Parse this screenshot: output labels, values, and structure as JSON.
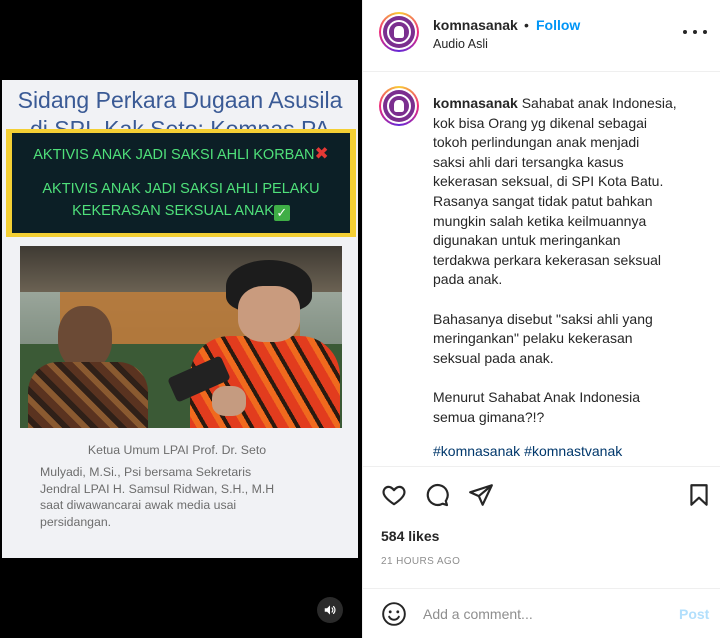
{
  "media": {
    "heading_line1": "Sidang Perkara Dugaan Asusila",
    "heading_line2": "di SPI, Kak Seto: Komnas PA",
    "banner_line1": "AKTIVIS ANAK JADI SAKSI AHLI KORBAN",
    "banner_line2": "AKTIVIS ANAK JADI SAKSI AHLI PELAKU",
    "banner_line3": "KEKERASAN SEKSUAL ANAK",
    "photo_caption": {
      "line1": "Ketua Umum LPAI Prof. Dr. Seto",
      "line2": "Mulyadi, M.Si., Psi bersama Sekretaris",
      "line3": "Jendral LPAI H. Samsul Ridwan, S.H., M.H",
      "line4": "saat diwawancarai awak media usai",
      "line5": "persidangan."
    },
    "audio_icon": "speaker-icon"
  },
  "post": {
    "username": "komnasanak",
    "separator": "•",
    "follow_label": "Follow",
    "audio_label": "Audio Asli",
    "caption": {
      "username": "komnasanak",
      "lines": [
        "Sahabat anak Indonesia,",
        "kok bisa Orang yg dikenal sebagai",
        "tokoh perlindungan anak menjadi",
        "saksi ahli dari tersangka kasus",
        "kekerasan seksual, di SPI Kota Batu.",
        "Rasanya sangat tidak patut bahkan",
        "mungkin salah ketika keilmuannya",
        "digunakan untuk meringankan",
        "terdakwa perkara kekerasan seksual",
        "pada anak.",
        "",
        "Bahasanya disebut \"saksi ahli yang",
        "meringankan\" pelaku kekerasan",
        "seksual pada anak.",
        "",
        "Menurut Sahabat Anak Indonesia",
        "semua gimana?!?"
      ]
    },
    "hashtags": [
      "#komnasanak",
      "#komnastvanak"
    ],
    "likes": "584 likes",
    "time_ago": "21 HOURS AGO",
    "comment_placeholder": "Add a comment...",
    "post_button": "Post",
    "colors": {
      "link": "#0095f6",
      "hashtag": "#00376b",
      "post_disabled": "#b2dffc"
    }
  }
}
